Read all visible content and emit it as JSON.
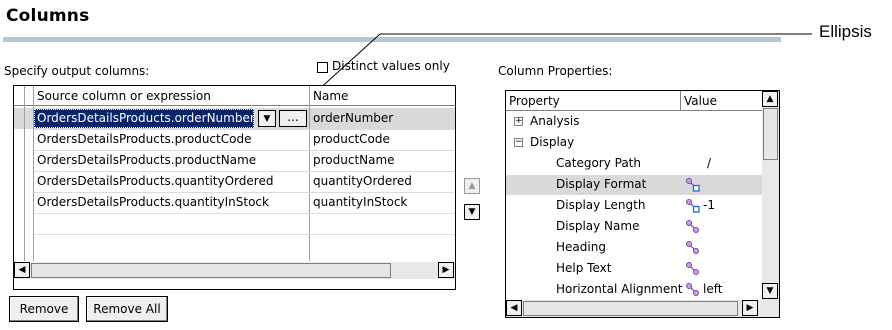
{
  "section": {
    "title": "Columns"
  },
  "output": {
    "label": "Specify output columns:",
    "distinct_label": "Distinct values only",
    "distinct_checked": false
  },
  "grid": {
    "headers": [
      "Source column or expression",
      "Name"
    ],
    "rows": [
      {
        "source": "OrdersDetailsProducts.orderNumber",
        "name": "orderNumber",
        "selected": true
      },
      {
        "source": "OrdersDetailsProducts.productCode",
        "name": "productCode"
      },
      {
        "source": "OrdersDetailsProducts.productName",
        "name": "productName"
      },
      {
        "source": "OrdersDetailsProducts.quantityOrdered",
        "name": "quantityOrdered"
      },
      {
        "source": "OrdersDetailsProducts.quantityInStock",
        "name": "quantityInStock"
      }
    ],
    "ellipsis_label": "..."
  },
  "buttons": {
    "remove": "Remove",
    "remove_all": "Remove All"
  },
  "properties": {
    "label": "Column Properties:",
    "headers": [
      "Property",
      "Value"
    ],
    "groups": [
      {
        "label": "Analysis",
        "expander": "+"
      },
      {
        "label": "Display",
        "expander": "−"
      }
    ],
    "items": [
      {
        "name": "Category Path",
        "value": "/",
        "icon": "none"
      },
      {
        "name": "Display Format",
        "value": "",
        "icon": "format-link-icon",
        "selected": true
      },
      {
        "name": "Display Length",
        "value": "-1",
        "icon": "format-link-icon"
      },
      {
        "name": "Display Name",
        "value": "",
        "icon": "link-icon"
      },
      {
        "name": "Heading",
        "value": "",
        "icon": "link-icon"
      },
      {
        "name": "Help Text",
        "value": "",
        "icon": "link-icon"
      },
      {
        "name": "Horizontal Alignment",
        "value": "left",
        "icon": "link-icon"
      }
    ]
  },
  "callout": {
    "label": "Ellipsis"
  },
  "colors": {
    "rule": "#b7c3d7",
    "selection": "#d9d9d9",
    "cell_selection": "#0a246a"
  }
}
